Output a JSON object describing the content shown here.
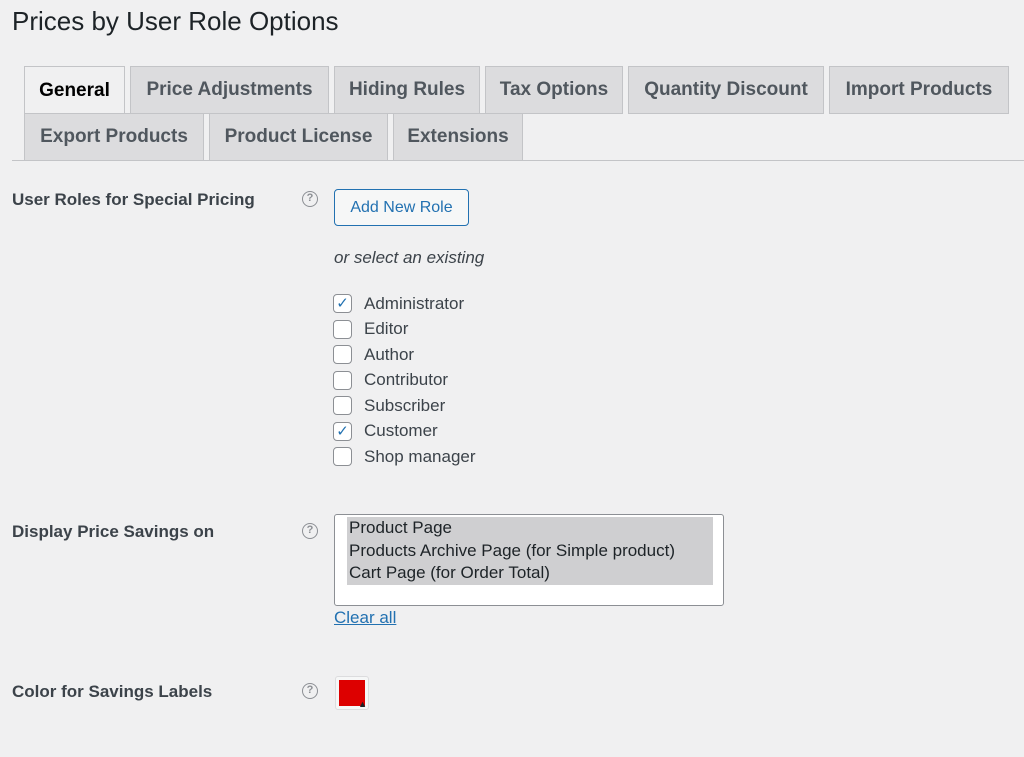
{
  "page": {
    "title": "Prices by User Role Options"
  },
  "tabs": [
    {
      "label": "General",
      "active": true
    },
    {
      "label": "Price Adjustments"
    },
    {
      "label": "Hiding Rules"
    },
    {
      "label": "Tax Options"
    },
    {
      "label": "Quantity Discount"
    },
    {
      "label": "Import Products"
    },
    {
      "label": "Export Products"
    },
    {
      "label": "Product License"
    },
    {
      "label": "Extensions"
    }
  ],
  "user_roles": {
    "label": "User Roles for Special Pricing",
    "help_icon": "question-circle-icon",
    "add_button": "Add New Role",
    "note": "or select an existing",
    "roles": [
      {
        "label": "Administrator",
        "checked": true
      },
      {
        "label": "Editor",
        "checked": false
      },
      {
        "label": "Author",
        "checked": false
      },
      {
        "label": "Contributor",
        "checked": false
      },
      {
        "label": "Subscriber",
        "checked": false
      },
      {
        "label": "Customer",
        "checked": true
      },
      {
        "label": "Shop manager",
        "checked": false
      }
    ]
  },
  "price_savings": {
    "label": "Display Price Savings on",
    "options": [
      "Product Page",
      "Products Archive Page (for Simple product)",
      "Cart Page (for Order Total)"
    ],
    "clear_link": "Clear all"
  },
  "savings_color": {
    "label": "Color for Savings Labels",
    "value": "#dd0000"
  },
  "colors": {
    "accent": "#2271b1",
    "check": "#2271b1"
  }
}
